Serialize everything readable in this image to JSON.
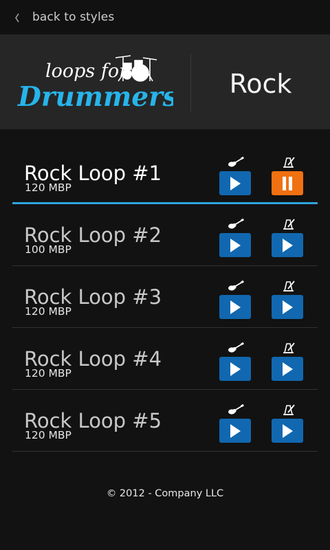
{
  "nav": {
    "back_label": "back to styles"
  },
  "header": {
    "logo": {
      "line1": "loops for",
      "line2": "Drummers"
    },
    "style_title": "Rock"
  },
  "loops": [
    {
      "name": "Rock Loop #1",
      "bpm": "120 MBP",
      "guitar_state": "play",
      "metronome_state": "pause",
      "active": true
    },
    {
      "name": "Rock Loop #2",
      "bpm": "100 MBP",
      "guitar_state": "play",
      "metronome_state": "play",
      "active": false
    },
    {
      "name": "Rock Loop #3",
      "bpm": "120 MBP",
      "guitar_state": "play",
      "metronome_state": "play",
      "active": false
    },
    {
      "name": "Rock Loop #4",
      "bpm": "120 MBP",
      "guitar_state": "play",
      "metronome_state": "play",
      "active": false
    },
    {
      "name": "Rock Loop #5",
      "bpm": "120 MBP",
      "guitar_state": "play",
      "metronome_state": "play",
      "active": false
    }
  ],
  "icons": {
    "back": "chevron-left-icon",
    "track_a": "guitar-icon",
    "track_b": "metronome-icon",
    "play": "play-icon",
    "pause": "pause-icon",
    "logo_art": "drum-kit-icon"
  },
  "colors": {
    "background": "#121212",
    "header_bg": "#262626",
    "button_blue": "#1168b0",
    "button_orange": "#f07111",
    "active_underline": "#2ea6e0",
    "logo_blue": "#27b4ea"
  },
  "footer": {
    "copyright": "© 2012 - Company LLC"
  }
}
